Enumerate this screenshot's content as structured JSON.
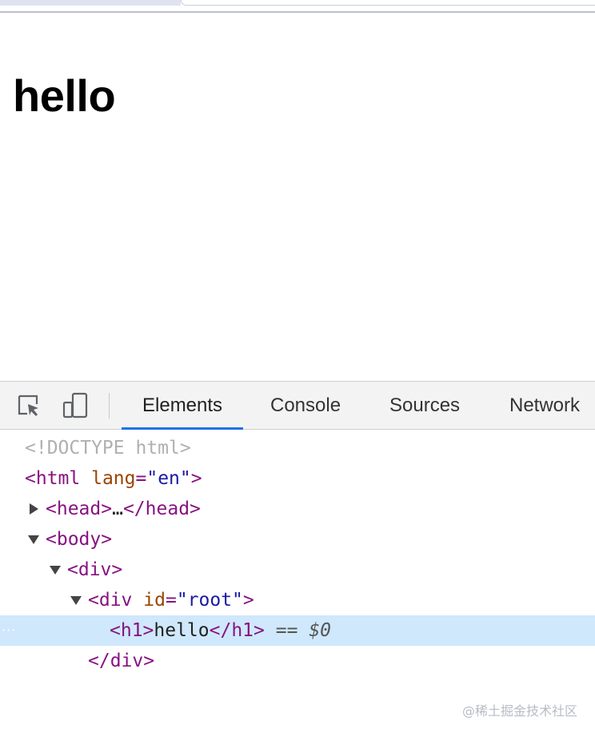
{
  "page": {
    "heading": "hello"
  },
  "devtools": {
    "toolbar": {
      "inspect_icon": "inspect-element-icon",
      "device_icon": "device-toggle-icon"
    },
    "tabs": [
      {
        "label": "Elements",
        "active": true
      },
      {
        "label": "Console",
        "active": false
      },
      {
        "label": "Sources",
        "active": false
      },
      {
        "label": "Network",
        "active": false
      }
    ],
    "dom": {
      "doctype": "<!DOCTYPE html>",
      "html_open": "<html",
      "html_attr": "lang",
      "html_val": "\"en\"",
      "html_close": ">",
      "head_open": "<head>",
      "head_ellipsis": "…",
      "head_close": "</head>",
      "body_open": "<body>",
      "div_open": "<div>",
      "div2_open": "<div",
      "div2_attr": "id",
      "div2_val": "\"root\"",
      "div2_close": ">",
      "h1_open": "<h1>",
      "h1_text": "hello",
      "h1_close": "</h1>",
      "selected_eq": "==",
      "selected_ref": "$0",
      "selected_dots": "···",
      "div_end": "</div>"
    },
    "watermark": "@稀土掘金技术社区"
  },
  "colors": {
    "tag": "#881280",
    "attr_name": "#994500",
    "attr_value": "#1a1aa6",
    "selected_row": "#cfe8fc",
    "active_tab_underline": "#1a73e8"
  }
}
